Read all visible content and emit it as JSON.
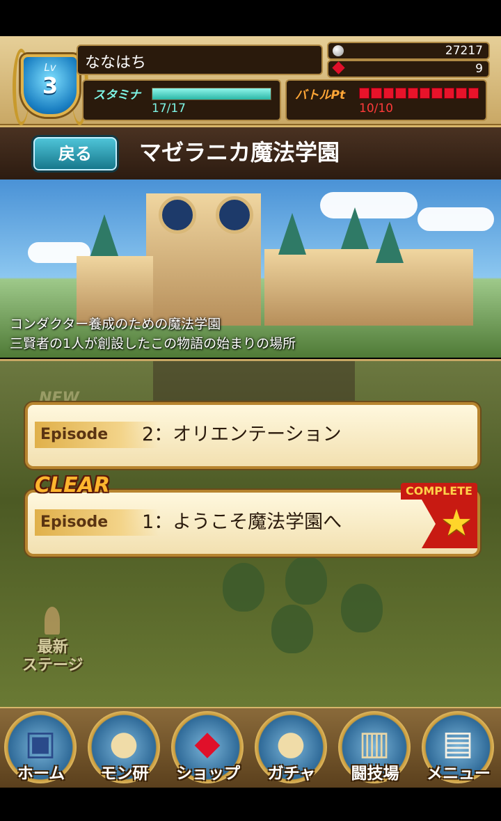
{
  "player": {
    "level_label": "Lv",
    "level": "3",
    "name": "ななはち"
  },
  "currency": {
    "coins": "27217",
    "gems": "9"
  },
  "stamina": {
    "label": "スタミナ",
    "value": "17/17",
    "fraction": 1.0
  },
  "battle_pt": {
    "label": "バトルPt",
    "value": "10/10",
    "segments_filled": 10
  },
  "header": {
    "back_label": "戻る",
    "title": "マゼラニカ魔法学園"
  },
  "scene": {
    "description_line1": "コンダクター養成のための魔法学園",
    "description_line2": "三賢者の1人が創設したこの物語の始まりの場所"
  },
  "episodes": [
    {
      "tag": "Episode",
      "title": "2：オリエンテーション",
      "badge": "NEW"
    },
    {
      "tag": "Episode",
      "title": "1：ようこそ魔法学園へ",
      "badge": "CLEAR",
      "ribbon": "COMPLETE",
      "icon": "star-icon"
    }
  ],
  "map": {
    "latest_stage_line1": "最新",
    "latest_stage_line2": "ステージ"
  },
  "nav": [
    {
      "label": "ホーム",
      "icon": "book-icon"
    },
    {
      "label": "モン研",
      "icon": "monster-icon"
    },
    {
      "label": "ショップ",
      "icon": "gem-icon"
    },
    {
      "label": "ガチャ",
      "icon": "gacha-icon"
    },
    {
      "label": "闘技場",
      "icon": "colosseum-icon"
    },
    {
      "label": "メニュー",
      "icon": "card-icon"
    }
  ],
  "colors": {
    "stamina": "#7ef5e6",
    "battle": "#e8132a",
    "accent_gold": "#d8b66a",
    "back_button": "#2fa6bd"
  }
}
